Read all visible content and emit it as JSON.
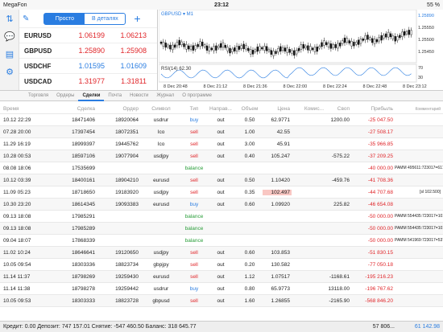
{
  "status": {
    "carrier": "MegaFon",
    "time": "23:12",
    "battery": "55 %"
  },
  "quotes": {
    "tabs": [
      "Просто",
      "В деталях"
    ],
    "rows": [
      {
        "symbol": "EURUSD",
        "bid": "1.06199",
        "ask": "1.06213",
        "color": "red"
      },
      {
        "symbol": "GBPUSD",
        "bid": "1.25890",
        "ask": "1.25908",
        "color": "red"
      },
      {
        "symbol": "USDCHF",
        "bid": "1.01595",
        "ask": "1.01609",
        "color": "blue"
      },
      {
        "symbol": "USDCAD",
        "bid": "1.31977",
        "ask": "1.31811",
        "color": "red"
      }
    ]
  },
  "chart": {
    "symbol_label": "GBPUSD ▾ M1",
    "rsi_label": "RSI(14) 62.30",
    "price_labels": [
      "1.25890",
      "1.25550",
      "1.25500",
      "1.25450"
    ],
    "rsi_levels": [
      "70",
      "30"
    ],
    "times": [
      "8 Dec 20:48",
      "8 Dec 21:12",
      "8 Dec 21:36",
      "8 Dec 22:00",
      "8 Dec 22:24",
      "8 Dec 22:48",
      "8 Dec 23:12"
    ]
  },
  "tabs": [
    "Торговля",
    "Ордеры",
    "Сделки",
    "Почта",
    "Новости",
    "Журнал",
    "О программе"
  ],
  "columns": [
    "Время",
    "Сделка",
    "Ордер",
    "Символ",
    "Тип",
    "Направ...",
    "Объем",
    "Цена",
    "Комис...",
    "Своп",
    "Прибыль",
    "Комментарий"
  ],
  "rows": [
    {
      "time": "10.12 22:29",
      "deal": "18471406",
      "order": "18920064",
      "sym": "usdrur",
      "type": "buy",
      "dir": "out",
      "vol": "0.50",
      "price": "62.9771",
      "comm": "",
      "swap": "1200.00",
      "profit": "-25 047.50",
      "comment": ""
    },
    {
      "time": "07.28 20:00",
      "deal": "17397454",
      "order": "18072351",
      "sym": "Ico",
      "type": "sell",
      "dir": "out",
      "vol": "1.00",
      "price": "42.55",
      "comm": "",
      "swap": "",
      "profit": "-27 508.17",
      "comment": ""
    },
    {
      "time": "11.29 16:19",
      "deal": "18999397",
      "order": "19445762",
      "sym": "Ico",
      "type": "sell",
      "dir": "out",
      "vol": "3.00",
      "price": "45.91",
      "comm": "",
      "swap": "",
      "profit": "-35 966.85",
      "comment": ""
    },
    {
      "time": "10.28 00:53",
      "deal": "18597106",
      "order": "19077904",
      "sym": "usdjpy",
      "type": "sell",
      "dir": "out",
      "vol": "0.40",
      "price": "105.247",
      "comm": "",
      "swap": "-575.22",
      "profit": "-37 209.25",
      "comment": ""
    },
    {
      "time": "08.08 18:06",
      "deal": "17535699",
      "order": "",
      "sym": "",
      "type": "balance",
      "dir": "",
      "vol": "",
      "price": "",
      "comm": "",
      "swap": "",
      "profit": "-40 000.00",
      "comment": "PAMM 495611:723017=61713"
    },
    {
      "time": "10.12 03:39",
      "deal": "18400161",
      "order": "18904210",
      "sym": "eurusd",
      "type": "sell",
      "dir": "out",
      "vol": "0.50",
      "price": "1.10420",
      "comm": "",
      "swap": "-459.76",
      "profit": "-41 708.36",
      "comment": ""
    },
    {
      "time": "11.09 05:23",
      "deal": "18718650",
      "order": "19183920",
      "sym": "usdjpy",
      "type": "sell",
      "dir": "out",
      "vol": "0.35",
      "price": "102.497",
      "comm": "",
      "swap": "",
      "profit": "-44 707.68",
      "comment": "[sl 102.500]",
      "hl": true
    },
    {
      "time": "10.30 23:20",
      "deal": "18614345",
      "order": "19093383",
      "sym": "eurusd",
      "type": "buy",
      "dir": "out",
      "vol": "0.60",
      "price": "1.09920",
      "comm": "",
      "swap": "225.82",
      "profit": "-46 654.08",
      "comment": ""
    },
    {
      "time": "09.13 18:08",
      "deal": "17985291",
      "order": "",
      "sym": "",
      "type": "balance",
      "dir": "",
      "vol": "",
      "price": "",
      "comm": "",
      "swap": "",
      "profit": "-50 000.00",
      "comment": "PAMM 554435:723017=10195"
    },
    {
      "time": "09.13 18:08",
      "deal": "17985289",
      "order": "",
      "sym": "",
      "type": "balance",
      "dir": "",
      "vol": "",
      "price": "",
      "comm": "",
      "swap": "",
      "profit": "-50 000.00",
      "comment": "PAMM 554435:723017=10195"
    },
    {
      "time": "09.04 18:07",
      "deal": "17868339",
      "order": "",
      "sym": "",
      "type": "balance",
      "dir": "",
      "vol": "",
      "price": "",
      "comm": "",
      "swap": "",
      "profit": "-50 000.00",
      "comment": "PAMM 541969:723017=53755"
    },
    {
      "time": "11.02 10:24",
      "deal": "18646641",
      "order": "19120650",
      "sym": "usdjpy",
      "type": "sell",
      "dir": "out",
      "vol": "0.60",
      "price": "103.853",
      "comm": "",
      "swap": "",
      "profit": "-51 830.15",
      "comment": ""
    },
    {
      "time": "10.05 09:54",
      "deal": "18303336",
      "order": "18823734",
      "sym": "gbpjpy",
      "type": "sell",
      "dir": "out",
      "vol": "0.20",
      "price": "130.582",
      "comm": "",
      "swap": "",
      "profit": "-77 050.18",
      "comment": ""
    },
    {
      "time": "11.14 11:37",
      "deal": "18798269",
      "order": "19259430",
      "sym": "eurusd",
      "type": "sell",
      "dir": "out",
      "vol": "1.12",
      "price": "1.07517",
      "comm": "",
      "swap": "-1168.61",
      "profit": "-195 216.23",
      "comment": ""
    },
    {
      "time": "11.14 11:38",
      "deal": "18798278",
      "order": "19259442",
      "sym": "usdrur",
      "type": "buy",
      "dir": "out",
      "vol": "0.80",
      "price": "65.9773",
      "comm": "",
      "swap": "13118.00",
      "profit": "-196 767.62",
      "comment": ""
    },
    {
      "time": "10.05 09:53",
      "deal": "18303333",
      "order": "18823728",
      "sym": "gbpusd",
      "type": "sell",
      "dir": "out",
      "vol": "1.60",
      "price": "1.26855",
      "comm": "",
      "swap": "-2165.90",
      "profit": "-568 846.20",
      "comment": ""
    }
  ],
  "footer": {
    "text": "Кредит: 0.00 Депозит: 747 157.01 Снятие: -547 460.50 Баланс: 318 645.77",
    "sum": "57 806...",
    "total": "61 142.98"
  }
}
